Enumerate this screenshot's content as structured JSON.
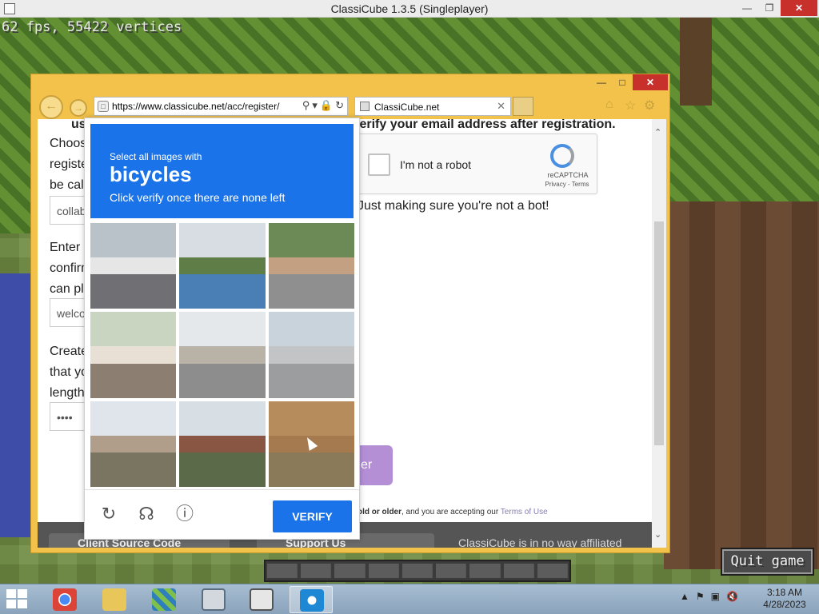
{
  "window": {
    "title": "ClassiCube 1.3.5 (Singleplayer)"
  },
  "game": {
    "fps_text": "62 fps, 55422 vertices",
    "quit_label": "Quit game"
  },
  "browser": {
    "url_host": "https://www.classicube.net",
    "url_path": "/acc/register/",
    "tab_title": "ClassiCube.net",
    "icons": [
      "back-icon",
      "forward-icon",
      "search-icon",
      "lock-icon",
      "refresh-icon",
      "home-icon",
      "star-icon",
      "gear-icon"
    ]
  },
  "page": {
    "top_note": "use a valid email address. You are required to verify your email address after registration.",
    "field1_label_lines": [
      "Choos",
      "registe",
      "be cal"
    ],
    "field1_value": "collab",
    "field2_label_lines": [
      "Enter",
      "confirm",
      "can pl"
    ],
    "field2_value": "welco",
    "field3_label_lines": [
      "Create",
      "that yo",
      "length"
    ],
    "field3_value": "••••",
    "robot_label": "I'm not a robot",
    "recaptcha_brand": "reCAPTCHA",
    "recaptcha_links": "Privacy - Terms",
    "bot_note": "Just making sure you're not a bot!",
    "register_button_fragment": "er",
    "terms_bold": "old or older",
    "terms_mid": ", and you are accepting our ",
    "terms_link": "Terms of Use",
    "footer_source": "Client Source Code",
    "footer_support": "Support Us",
    "footer_text": "ClassiCube is in no way affiliated"
  },
  "captcha": {
    "instruction_line1": "Select all images with",
    "target_word": "bicycles",
    "instruction_line3": "Click verify once there are none left",
    "verify_label": "VERIFY",
    "tiles": [
      {
        "desc": "cars-street",
        "sky": "#b9c2c9",
        "ground": "#6f6f74",
        "obj": "#e6e6e6"
      },
      {
        "desc": "roadside-fence",
        "sky": "#d7dde2",
        "ground": "#4a7fb5",
        "obj": "#5f7d47"
      },
      {
        "desc": "fire-hydrant",
        "sky": "#6b8a55",
        "ground": "#8f8f8f",
        "obj": "#c4a083"
      },
      {
        "desc": "house-bicycle",
        "sky": "#c9d5c0",
        "ground": "#8c7f72",
        "obj": "#e8e0d4"
      },
      {
        "desc": "garage-street",
        "sky": "#e5e8ea",
        "ground": "#8d8d8d",
        "obj": "#b9b2a6"
      },
      {
        "desc": "concrete-wall",
        "sky": "#c9d3dc",
        "ground": "#9b9d9e",
        "obj": "#c2c4c5"
      },
      {
        "desc": "houses-roadside",
        "sky": "#dfe5ea",
        "ground": "#7a7560",
        "obj": "#b09e8a"
      },
      {
        "desc": "brick-building",
        "sky": "#d8dfe4",
        "ground": "#5b6b4a",
        "obj": "#8a5644"
      },
      {
        "desc": "wooden-fence",
        "sky": "#b78c5d",
        "ground": "#8a7a5a",
        "obj": "#a47a4e"
      }
    ]
  },
  "taskbar": {
    "apps": [
      "chrome-icon",
      "file-explorer-icon",
      "classicube-launcher-icon",
      "monitor-icon",
      "classicube-icon",
      "internet-explorer-icon"
    ],
    "time": "3:18 AM",
    "date": "4/28/2023"
  }
}
